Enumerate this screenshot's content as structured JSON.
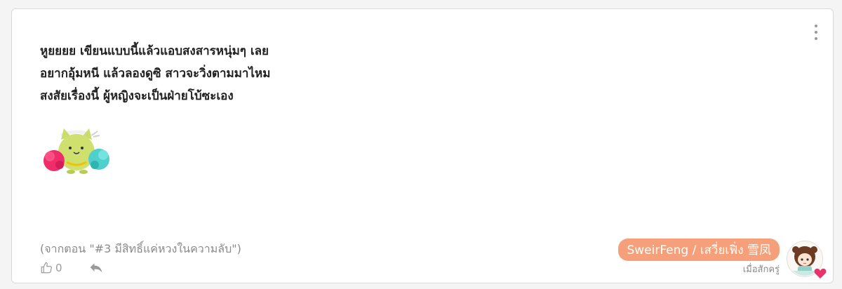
{
  "comment": {
    "lines": [
      "หูยยยย เขียนแบบนี้แล้วแอบสงสารหนุ่มๆ เลย",
      "อยากอุ้มหนี แล้วลองดูซิ สาวจะวิ่งตามมาไหม",
      "สงสัยเรื่องนี้ ผู้หญิงจะเป็นฝ่ายโบ้ซะเอง"
    ],
    "source": "(จากตอน \"#3 มีสิทธิ์แค่หวงในความลับ\")"
  },
  "actions": {
    "like_count": "0",
    "like_icon": "thumbs-up-icon",
    "reply_icon": "reply-icon",
    "more_icon": "more-vertical-icon"
  },
  "author": {
    "name": "SweirFeng / เสวี่ยเฟิ่ง 雪凤",
    "timestamp": "เมื่อสักครู่",
    "badge_color": "#f5a07a"
  },
  "sticker": {
    "icon": "cheerleader-cat-sticker"
  }
}
